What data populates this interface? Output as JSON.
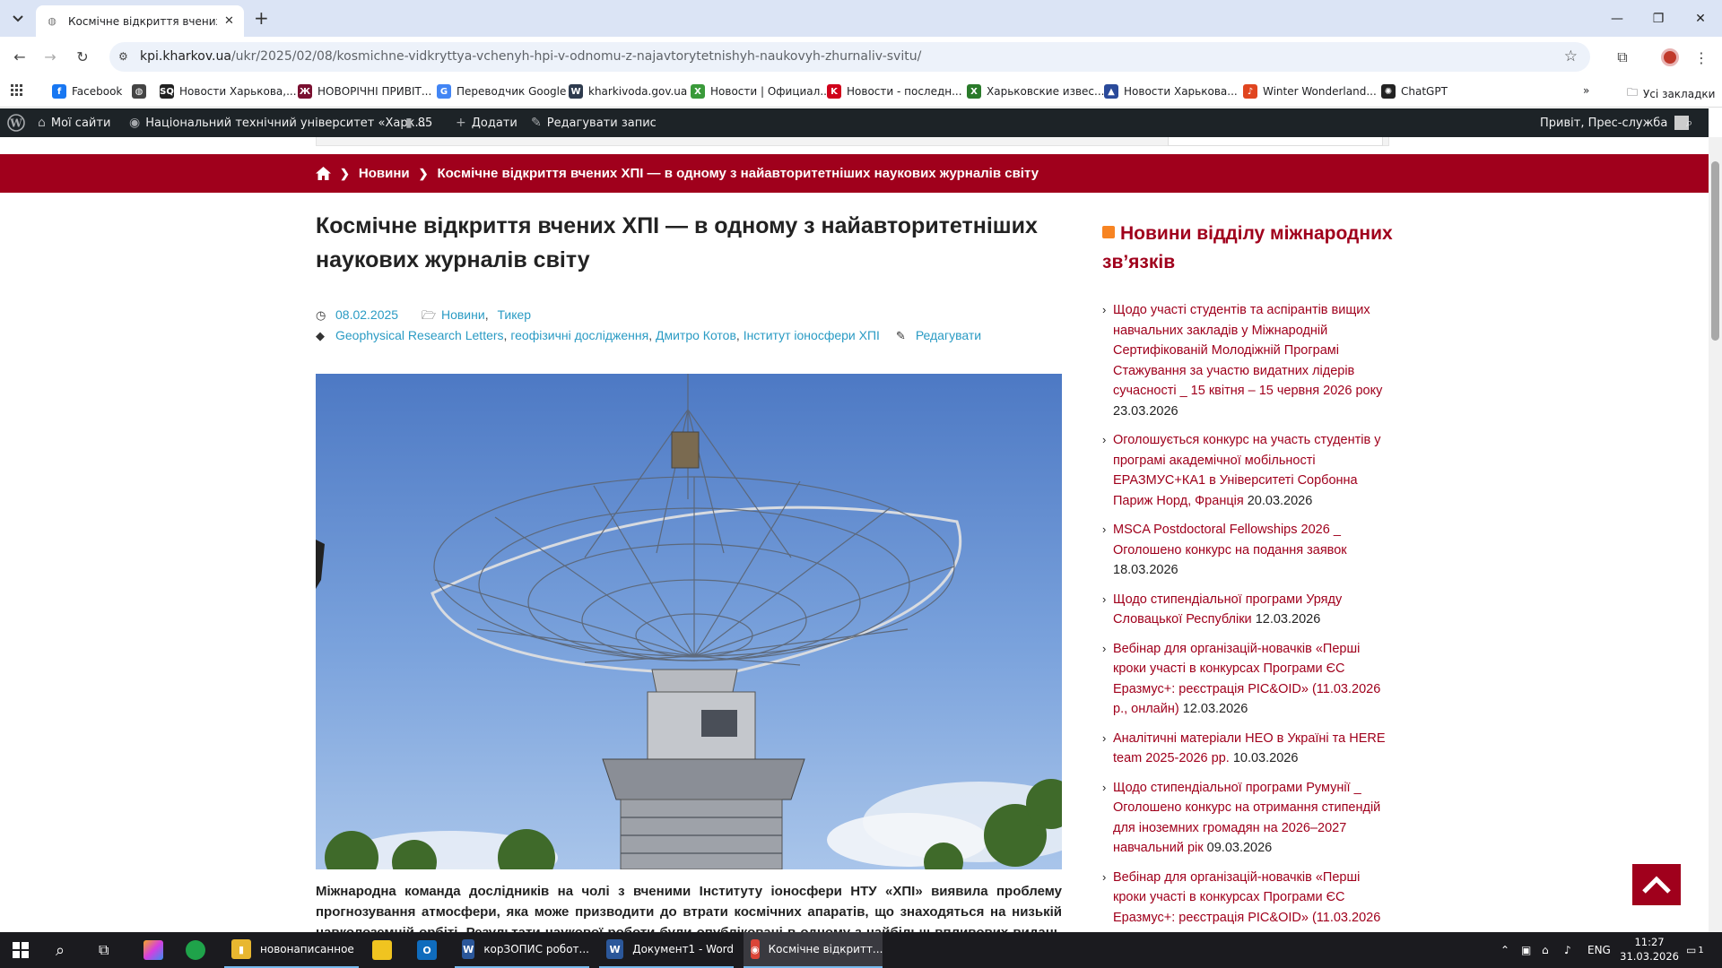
{
  "browser": {
    "tab_title": "Космічне відкриття вчених ХП",
    "url_host": "kpi.kharkov.ua",
    "url_path": "/ukr/2025/02/08/kosmichne-vidkryttya-vchenyh-hpi-v-odnomu-z-najavtorytetnishyh-naukovyh-zhurnaliv-svitu/"
  },
  "bookmarks": [
    {
      "label": "Facebook",
      "icon": "facebook-icon",
      "color": "#1877f2",
      "glyph": "f"
    },
    {
      "label": "",
      "icon": "globe-icon",
      "color": "#444444",
      "glyph": "◍"
    },
    {
      "label": "Новости Харькова,...",
      "icon": "sq-icon",
      "color": "#222222",
      "glyph": "SQ"
    },
    {
      "label": "НОВОРІЧНІ ПРИВІТ...",
      "icon": "hpi-icon",
      "color": "#7a1030",
      "glyph": "Ж"
    },
    {
      "label": "Переводчик Google",
      "icon": "google-translate-icon",
      "color": "#4285f4",
      "glyph": "G"
    },
    {
      "label": "kharkivoda.gov.ua",
      "icon": "kharkivoda-icon",
      "color": "#2e3b4e",
      "glyph": "W"
    },
    {
      "label": "Новости | Официал...",
      "icon": "news-official-icon",
      "color": "#3a9a3a",
      "glyph": "Х"
    },
    {
      "label": "Новости - последн...",
      "icon": "k-news-icon",
      "color": "#d0021b",
      "glyph": "K"
    },
    {
      "label": "Харьковские извес...",
      "icon": "kharkiv-izvestia-icon",
      "color": "#2a7a2a",
      "glyph": "Х"
    },
    {
      "label": "Новости Харькова...",
      "icon": "triangle-news-icon",
      "color": "#2a4a9a",
      "glyph": "▲"
    },
    {
      "label": "Winter Wonderland...",
      "icon": "winter-icon",
      "color": "#e0451f",
      "glyph": "♪"
    },
    {
      "label": "ChatGPT",
      "icon": "chatgpt-icon",
      "color": "#222222",
      "glyph": "✺"
    }
  ],
  "bookmarks_all": "Усі закладки",
  "wp_admin": {
    "my_sites": "Мої сайти",
    "site_name": "Національний технічний університет «Харк...",
    "comments": "85",
    "add": "Додати",
    "edit": "Редагувати запис",
    "greeting": "Привіт, Прес-служба"
  },
  "breadcrumb": {
    "section": "Новини",
    "current": "Космічне відкриття вчених ХПІ — в одному з найавторитетніших наукових журналів світу"
  },
  "article": {
    "title": "Космічне відкриття вчених ХПІ — в одному з найавторитетніших наукових журналів світу",
    "date": "08.02.2025",
    "categories": [
      "Новини",
      "Тикер"
    ],
    "tags": [
      "Geophysical Research Letters",
      "геофізичні дослідження",
      "Дмитро Котов",
      "Інститут іоносфери ХПІ"
    ],
    "edit_link": "Редагувати",
    "lead": "Міжнародна команда дослідників на чолі з вченими Інституту іоносфери НТУ «ХПІ» виявила проблему прогнозування атмосфери, яка може призводити до втрати космічних апаратів, що знаходяться на низькій навколоземній орбіті. Результати наукової роботи були опубліковані в одному з найбільш впливових видань світу"
  },
  "sidebar": {
    "title": "Новини відділу міжнародних зв’язків",
    "items": [
      {
        "text": "Щодо участі студентів та аспірантів вищих навчальних закладів у Міжнародній Сертифікованій Молодіжній Програмі Стажування за участю видатних лідерів сучасності _ 15 квітня – 15 червня 2026 року",
        "date": "23.03.2026"
      },
      {
        "text": "Оголошується конкурс на участь студентів у програмі академічної мобільності ЕРАЗМУС+КА1 в Університеті Сорбонна Париж Норд, Франція",
        "date": "20.03.2026"
      },
      {
        "text": "MSCA Postdoctoral Fellowships 2026 _ Оголошено конкурс на подання заявок",
        "date": "18.03.2026"
      },
      {
        "text": "Щодо стипендіальної програми Уряду Словацької Республіки",
        "date": "12.03.2026"
      },
      {
        "text": "Вебінар для організацій-новачків «Перші кроки участі в конкурсах Програми ЄС Еразмус+: реєстрація PIC&OID» (11.03.2026 р., онлайн)",
        "date": "12.03.2026"
      },
      {
        "text": "Аналітичні матеріали НЕО в Україні та HERE team 2025-2026 рр.",
        "date": "10.03.2026"
      },
      {
        "text": "Щодо стипендіальної програми Румунії _ Оголошено конкурс на отримання стипендій для іноземних громадян на 2026–2027 навчальний рік",
        "date": "09.03.2026"
      },
      {
        "text": "Вебінар для організацій-новачків «Перші кроки участі в конкурсах Програми ЄС Еразмус+: реєстрація PIC&OID» (11.03.2026",
        "date": ""
      }
    ]
  },
  "taskbar": {
    "apps": [
      {
        "label": "новонаписанное",
        "icon": "folder-icon",
        "color": "#e8b730",
        "glyph": "▮"
      },
      {
        "label": "корЗОПИС робот...",
        "icon": "word-icon",
        "color": "#2b579a",
        "glyph": "W"
      },
      {
        "label": "Документ1 - Word",
        "icon": "word-icon",
        "color": "#2b579a",
        "glyph": "W"
      },
      {
        "label": "Космічне відкритт...",
        "icon": "chrome-icon",
        "color": "#db4437",
        "glyph": "◉"
      }
    ],
    "lang": "ENG",
    "time": "11:27",
    "date": "31.03.2026",
    "notif_count": "1"
  },
  "colors": {
    "brand": "#a0001c",
    "link": "#2a9bc4",
    "wpbar": "#1d2327"
  }
}
